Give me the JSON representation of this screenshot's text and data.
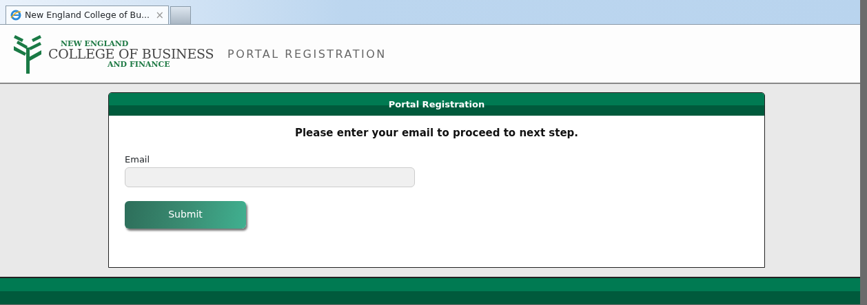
{
  "browser": {
    "tabs": [
      {
        "title": "New England College of Bu...",
        "close": "×",
        "selected": true
      }
    ]
  },
  "header": {
    "logo_lines": [
      "NEW ENGLAND",
      "COLLEGE OF BUSINESS",
      "AND FINANCE"
    ],
    "title": "PORTAL REGISTRATION"
  },
  "panel": {
    "title": "Portal Registration",
    "instruction": "Please enter your email to proceed to next step.",
    "field": {
      "label": "Email"
    },
    "submit": "Submit"
  }
}
